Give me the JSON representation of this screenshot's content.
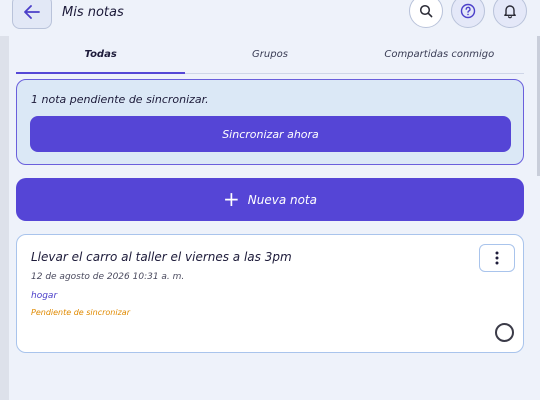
{
  "header": {
    "title": "Mis notas",
    "back_icon": "arrow-left-icon",
    "search_icon": "search-icon",
    "help_icon": "help-circle-icon",
    "bell_icon": "bell-icon"
  },
  "tabs": [
    {
      "label": "Todas",
      "active": true
    },
    {
      "label": "Grupos",
      "active": false
    },
    {
      "label": "Compartidas conmigo",
      "active": false
    }
  ],
  "sync_banner": {
    "message": "1 nota pendiente de sincronizar.",
    "button_label": "Sincronizar ahora"
  },
  "new_note_button": {
    "label": "Nueva nota",
    "icon": "plus-icon"
  },
  "notes": [
    {
      "title": "Llevar el carro al taller el viernes a las 3pm",
      "date": "12 de agosto de 2026 10:31 a. m.",
      "tag": "hogar",
      "status": "Pendiente de sincronizar",
      "more_icon": "more-vertical-icon",
      "completed": false
    }
  ],
  "colors": {
    "accent": "#5545d6",
    "background": "#eef2fa",
    "pending": "#e08a00",
    "tag": "#4b3fc9"
  }
}
